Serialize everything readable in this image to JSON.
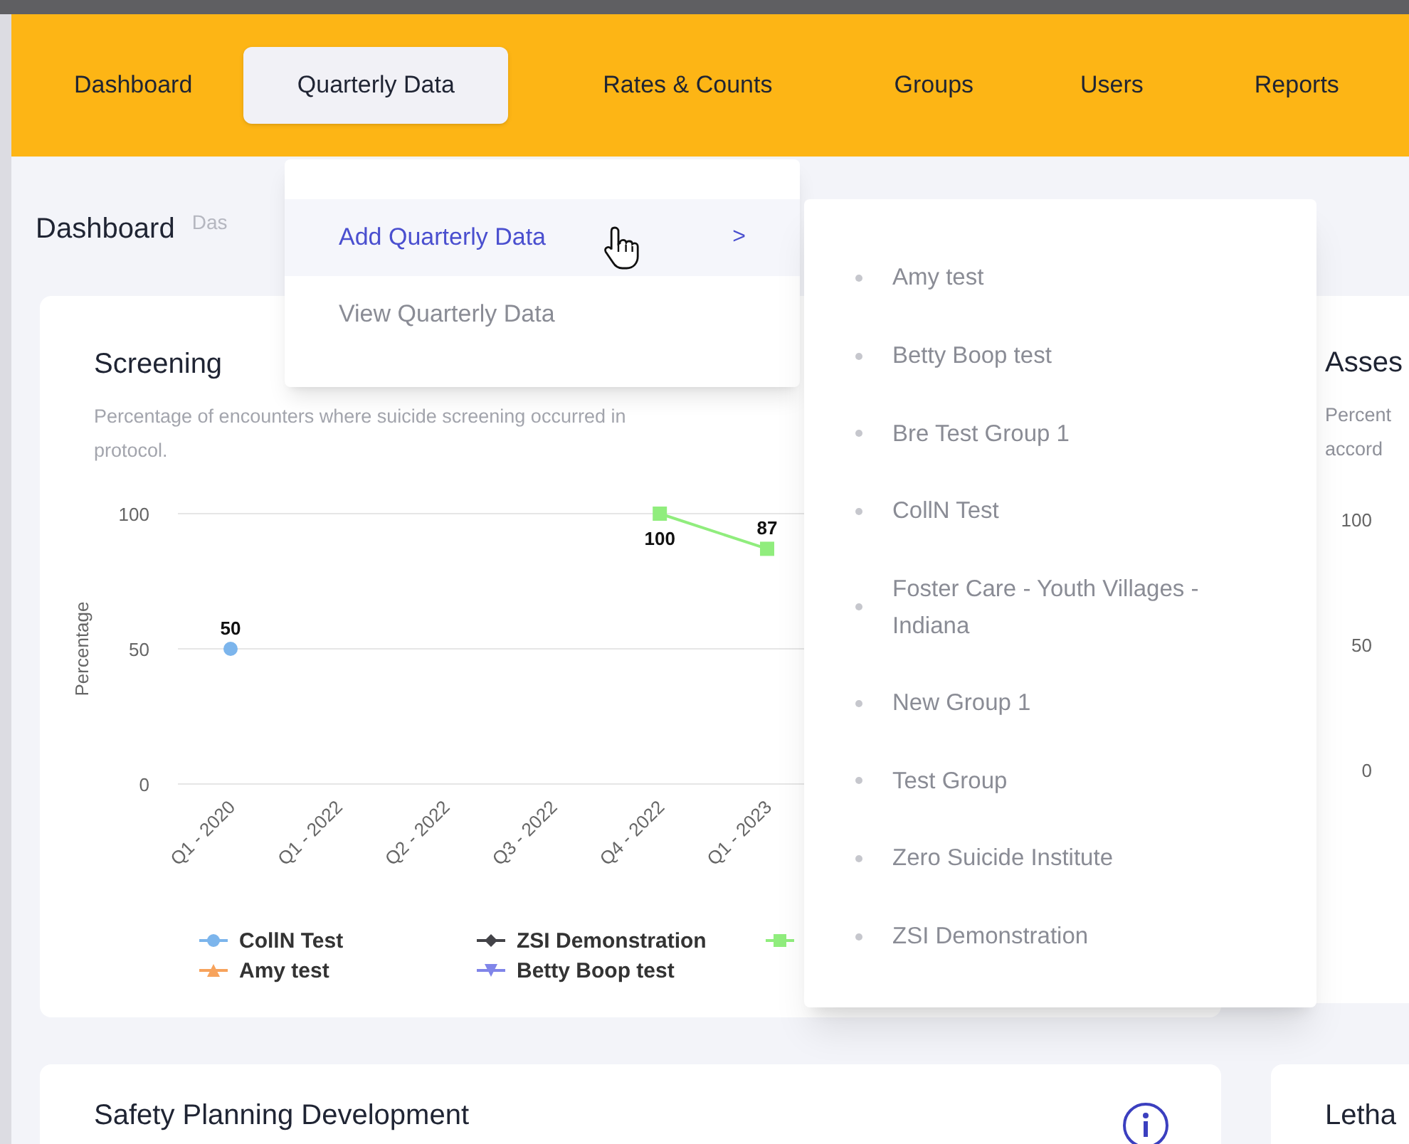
{
  "nav": {
    "tabs": [
      {
        "label": "Dashboard",
        "selected": false
      },
      {
        "label": "Quarterly Data",
        "selected": true
      },
      {
        "label": "Rates & Counts",
        "selected": false
      },
      {
        "label": "Groups",
        "selected": false
      },
      {
        "label": "Users",
        "selected": false
      },
      {
        "label": "Reports",
        "selected": false
      }
    ]
  },
  "page": {
    "title": "Dashboard",
    "breadcrumb": "Das"
  },
  "cards": [
    {
      "title": "Screening",
      "description": "Percentage of encounters where suicide screening occurred in\nprotocol.",
      "chart_data": {
        "type": "line",
        "ylabel": "Percentage",
        "categories": [
          "Q1 - 2020",
          "Q1 - 2022",
          "Q2 - 2022",
          "Q3 - 2022",
          "Q4 - 2022",
          "Q1 - 2023"
        ],
        "yticks": [
          0,
          50,
          100
        ],
        "ylim": [
          0,
          100
        ],
        "data_labels": true,
        "series": [
          {
            "name": "CollN Test",
            "color": "#7cb5ec",
            "marker": "circle",
            "values": [
              50,
              null,
              null,
              null,
              null,
              null
            ]
          },
          {
            "name": "ZSI Demonstration",
            "color": "#434348",
            "marker": "diamond",
            "values": [
              null,
              null,
              null,
              null,
              null,
              null
            ]
          },
          {
            "color": "#90ed7d",
            "marker": "square",
            "values": [
              null,
              null,
              null,
              null,
              100,
              87
            ]
          },
          {
            "name": "Amy test",
            "color": "#f7a35c",
            "marker": "triangle",
            "values": [
              null,
              null,
              null,
              null,
              null,
              null
            ]
          },
          {
            "name": "Betty Boop test",
            "color": "#8085e9",
            "marker": "triangle-down",
            "values": [
              null,
              null,
              null,
              null,
              null,
              null
            ]
          }
        ]
      }
    },
    {
      "title": "Asses",
      "description": "Percent\naccord",
      "axis_ticks": [
        "100",
        "50",
        "0"
      ]
    }
  ],
  "bottom_cards": [
    {
      "title": "Safety Planning Development",
      "info": true
    },
    {
      "title": "Letha",
      "info": false
    }
  ],
  "dropdown": {
    "items": [
      {
        "label": "Add Quarterly Data",
        "selected": true,
        "arrow": ">"
      },
      {
        "label": "View Quarterly Data",
        "selected": false
      }
    ]
  },
  "submenu": {
    "items": [
      "Amy test",
      "Betty Boop test",
      "Bre Test Group 1",
      "CollN Test",
      "Foster Care - Youth Villages -\nIndiana",
      "New Group 1",
      "Test Group",
      "Zero Suicide Institute",
      "ZSI Demonstration"
    ]
  }
}
